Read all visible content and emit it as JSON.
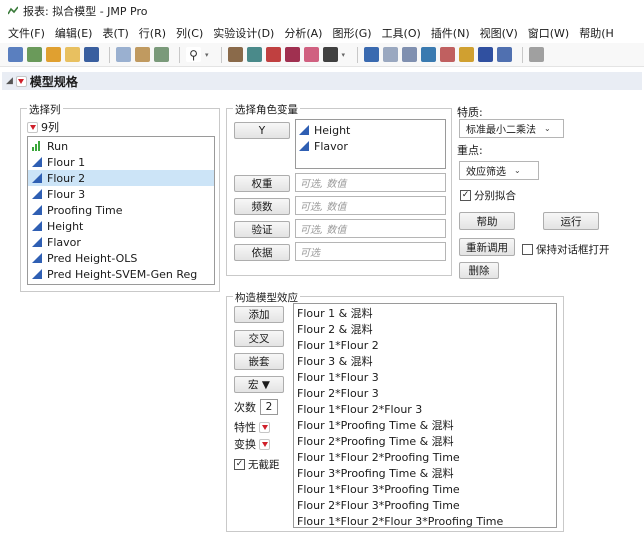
{
  "window": {
    "title": "报表: 拟合模型 - JMP Pro"
  },
  "menu": [
    "文件(F)",
    "编辑(E)",
    "表(T)",
    "行(R)",
    "列(C)",
    "实验设计(D)",
    "分析(A)",
    "图形(G)",
    "工具(O)",
    "插件(N)",
    "视图(V)",
    "窗口(W)",
    "帮助(H"
  ],
  "outline": {
    "title": "模型规格"
  },
  "select_columns": {
    "title": "选择列",
    "count": "9列",
    "items": [
      {
        "label": "Run",
        "icon": "nominal-icon"
      },
      {
        "label": "Flour 1",
        "icon": "continuous-icon"
      },
      {
        "label": "Flour 2",
        "icon": "continuous-icon",
        "selected": true
      },
      {
        "label": "Flour 3",
        "icon": "continuous-icon"
      },
      {
        "label": "Proofing Time",
        "icon": "continuous-icon"
      },
      {
        "label": "Height",
        "icon": "continuous-icon"
      },
      {
        "label": "Flavor",
        "icon": "continuous-icon"
      },
      {
        "label": "Pred Height-OLS",
        "icon": "continuous-icon"
      },
      {
        "label": "Pred Height-SVEM-Gen Reg",
        "icon": "continuous-icon"
      }
    ]
  },
  "roles": {
    "title": "选择角色变量",
    "y_label": "Y",
    "y_items": [
      "Height",
      "Flavor"
    ],
    "weight_label": "权重",
    "weight_placeholder": "可选, 数值",
    "freq_label": "频数",
    "freq_placeholder": "可选, 数值",
    "validation_label": "验证",
    "validation_placeholder": "可选, 数值",
    "by_label": "依据",
    "by_placeholder": "可选"
  },
  "personality": {
    "label": "特质:",
    "value": "标准最小二乘法",
    "emphasis_label": "重点:",
    "emphasis_value": "效应筛选",
    "fit_separately_label": "分别拟合",
    "fit_separately_checked": true,
    "help": "帮助",
    "run": "运行",
    "recall": "重新调用",
    "keep_dialog_label": "保持对话框打开",
    "keep_dialog_checked": false,
    "remove": "删除"
  },
  "effects": {
    "title": "构造模型效应",
    "add": "添加",
    "cross": "交叉",
    "nest": "嵌套",
    "macros": "宏 ▼",
    "degree_label": "次数",
    "degree_value": "2",
    "attributes_label": "特性",
    "transform_label": "变换",
    "no_intercept_label": "无截距",
    "no_intercept_checked": true,
    "items": [
      "Flour 1 & 混料",
      "Flour 2 & 混料",
      "Flour 1*Flour 2",
      "Flour 3 & 混料",
      "Flour 1*Flour 3",
      "Flour 2*Flour 3",
      "Flour 1*Flour 2*Flour 3",
      "Flour 1*Proofing Time & 混料",
      "Flour 2*Proofing Time & 混料",
      "Flour 1*Flour 2*Proofing Time",
      "Flour 3*Proofing Time & 混料",
      "Flour 1*Flour 3*Proofing Time",
      "Flour 2*Flour 3*Proofing Time",
      "Flour 1*Flour 2*Flour 3*Proofing Time"
    ]
  },
  "colors": {
    "accent_blue": "#2f5fb3",
    "selection": "#cce4f7",
    "red_triangle": "#d0202a",
    "nominal_green": "#3aa63a"
  }
}
